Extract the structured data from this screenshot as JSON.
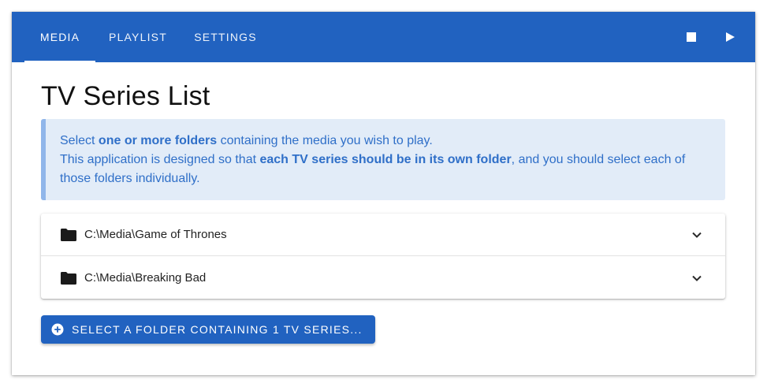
{
  "tabs": [
    {
      "label": "Media",
      "active": true
    },
    {
      "label": "Playlist",
      "active": false
    },
    {
      "label": "Settings",
      "active": false
    }
  ],
  "toolbar": {
    "stop_icon": "stop-icon",
    "play_icon": "play-icon"
  },
  "page": {
    "title": "TV Series List"
  },
  "info": {
    "line1_pre": "Select ",
    "line1_bold": "one or more folders",
    "line1_post": " containing the media you wish to play.",
    "line2_pre": "This application is designed so that ",
    "line2_bold": "each TV series should be in its own folder",
    "line2_post": ", and you should select each of those folders individually."
  },
  "folders": [
    {
      "path": "C:\\Media\\Game of Thrones",
      "icon": "folder-icon",
      "expand_icon": "chevron-down-icon"
    },
    {
      "path": "C:\\Media\\Breaking Bad",
      "icon": "folder-icon",
      "expand_icon": "chevron-down-icon"
    }
  ],
  "add_button": {
    "label": "Select a folder containing 1 TV series...",
    "icon": "plus-circle-icon"
  },
  "colors": {
    "primary": "#2162c0",
    "info_background": "#e2ecf8",
    "info_border": "#90b6ea",
    "info_text": "#2f6fc8"
  }
}
